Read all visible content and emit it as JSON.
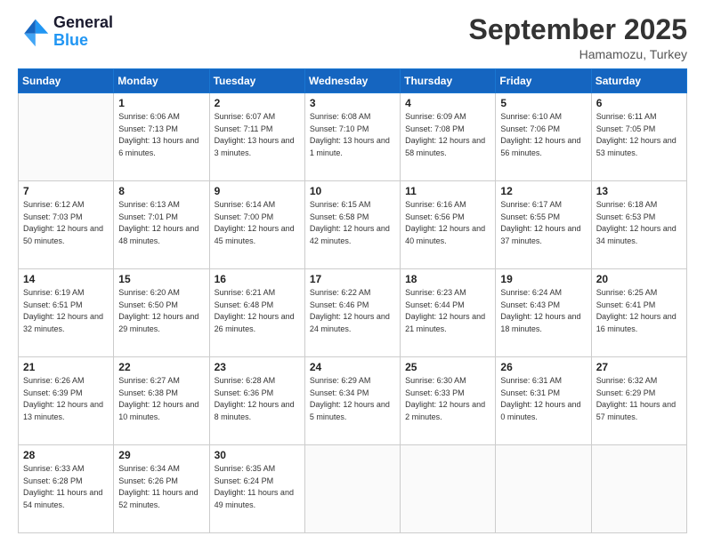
{
  "logo": {
    "line1": "General",
    "line2": "Blue"
  },
  "title": "September 2025",
  "subtitle": "Hamamozu, Turkey",
  "days_header": [
    "Sunday",
    "Monday",
    "Tuesday",
    "Wednesday",
    "Thursday",
    "Friday",
    "Saturday"
  ],
  "weeks": [
    [
      {
        "num": "",
        "sunrise": "",
        "sunset": "",
        "daylight": ""
      },
      {
        "num": "1",
        "sunrise": "Sunrise: 6:06 AM",
        "sunset": "Sunset: 7:13 PM",
        "daylight": "Daylight: 13 hours and 6 minutes."
      },
      {
        "num": "2",
        "sunrise": "Sunrise: 6:07 AM",
        "sunset": "Sunset: 7:11 PM",
        "daylight": "Daylight: 13 hours and 3 minutes."
      },
      {
        "num": "3",
        "sunrise": "Sunrise: 6:08 AM",
        "sunset": "Sunset: 7:10 PM",
        "daylight": "Daylight: 13 hours and 1 minute."
      },
      {
        "num": "4",
        "sunrise": "Sunrise: 6:09 AM",
        "sunset": "Sunset: 7:08 PM",
        "daylight": "Daylight: 12 hours and 58 minutes."
      },
      {
        "num": "5",
        "sunrise": "Sunrise: 6:10 AM",
        "sunset": "Sunset: 7:06 PM",
        "daylight": "Daylight: 12 hours and 56 minutes."
      },
      {
        "num": "6",
        "sunrise": "Sunrise: 6:11 AM",
        "sunset": "Sunset: 7:05 PM",
        "daylight": "Daylight: 12 hours and 53 minutes."
      }
    ],
    [
      {
        "num": "7",
        "sunrise": "Sunrise: 6:12 AM",
        "sunset": "Sunset: 7:03 PM",
        "daylight": "Daylight: 12 hours and 50 minutes."
      },
      {
        "num": "8",
        "sunrise": "Sunrise: 6:13 AM",
        "sunset": "Sunset: 7:01 PM",
        "daylight": "Daylight: 12 hours and 48 minutes."
      },
      {
        "num": "9",
        "sunrise": "Sunrise: 6:14 AM",
        "sunset": "Sunset: 7:00 PM",
        "daylight": "Daylight: 12 hours and 45 minutes."
      },
      {
        "num": "10",
        "sunrise": "Sunrise: 6:15 AM",
        "sunset": "Sunset: 6:58 PM",
        "daylight": "Daylight: 12 hours and 42 minutes."
      },
      {
        "num": "11",
        "sunrise": "Sunrise: 6:16 AM",
        "sunset": "Sunset: 6:56 PM",
        "daylight": "Daylight: 12 hours and 40 minutes."
      },
      {
        "num": "12",
        "sunrise": "Sunrise: 6:17 AM",
        "sunset": "Sunset: 6:55 PM",
        "daylight": "Daylight: 12 hours and 37 minutes."
      },
      {
        "num": "13",
        "sunrise": "Sunrise: 6:18 AM",
        "sunset": "Sunset: 6:53 PM",
        "daylight": "Daylight: 12 hours and 34 minutes."
      }
    ],
    [
      {
        "num": "14",
        "sunrise": "Sunrise: 6:19 AM",
        "sunset": "Sunset: 6:51 PM",
        "daylight": "Daylight: 12 hours and 32 minutes."
      },
      {
        "num": "15",
        "sunrise": "Sunrise: 6:20 AM",
        "sunset": "Sunset: 6:50 PM",
        "daylight": "Daylight: 12 hours and 29 minutes."
      },
      {
        "num": "16",
        "sunrise": "Sunrise: 6:21 AM",
        "sunset": "Sunset: 6:48 PM",
        "daylight": "Daylight: 12 hours and 26 minutes."
      },
      {
        "num": "17",
        "sunrise": "Sunrise: 6:22 AM",
        "sunset": "Sunset: 6:46 PM",
        "daylight": "Daylight: 12 hours and 24 minutes."
      },
      {
        "num": "18",
        "sunrise": "Sunrise: 6:23 AM",
        "sunset": "Sunset: 6:44 PM",
        "daylight": "Daylight: 12 hours and 21 minutes."
      },
      {
        "num": "19",
        "sunrise": "Sunrise: 6:24 AM",
        "sunset": "Sunset: 6:43 PM",
        "daylight": "Daylight: 12 hours and 18 minutes."
      },
      {
        "num": "20",
        "sunrise": "Sunrise: 6:25 AM",
        "sunset": "Sunset: 6:41 PM",
        "daylight": "Daylight: 12 hours and 16 minutes."
      }
    ],
    [
      {
        "num": "21",
        "sunrise": "Sunrise: 6:26 AM",
        "sunset": "Sunset: 6:39 PM",
        "daylight": "Daylight: 12 hours and 13 minutes."
      },
      {
        "num": "22",
        "sunrise": "Sunrise: 6:27 AM",
        "sunset": "Sunset: 6:38 PM",
        "daylight": "Daylight: 12 hours and 10 minutes."
      },
      {
        "num": "23",
        "sunrise": "Sunrise: 6:28 AM",
        "sunset": "Sunset: 6:36 PM",
        "daylight": "Daylight: 12 hours and 8 minutes."
      },
      {
        "num": "24",
        "sunrise": "Sunrise: 6:29 AM",
        "sunset": "Sunset: 6:34 PM",
        "daylight": "Daylight: 12 hours and 5 minutes."
      },
      {
        "num": "25",
        "sunrise": "Sunrise: 6:30 AM",
        "sunset": "Sunset: 6:33 PM",
        "daylight": "Daylight: 12 hours and 2 minutes."
      },
      {
        "num": "26",
        "sunrise": "Sunrise: 6:31 AM",
        "sunset": "Sunset: 6:31 PM",
        "daylight": "Daylight: 12 hours and 0 minutes."
      },
      {
        "num": "27",
        "sunrise": "Sunrise: 6:32 AM",
        "sunset": "Sunset: 6:29 PM",
        "daylight": "Daylight: 11 hours and 57 minutes."
      }
    ],
    [
      {
        "num": "28",
        "sunrise": "Sunrise: 6:33 AM",
        "sunset": "Sunset: 6:28 PM",
        "daylight": "Daylight: 11 hours and 54 minutes."
      },
      {
        "num": "29",
        "sunrise": "Sunrise: 6:34 AM",
        "sunset": "Sunset: 6:26 PM",
        "daylight": "Daylight: 11 hours and 52 minutes."
      },
      {
        "num": "30",
        "sunrise": "Sunrise: 6:35 AM",
        "sunset": "Sunset: 6:24 PM",
        "daylight": "Daylight: 11 hours and 49 minutes."
      },
      {
        "num": "",
        "sunrise": "",
        "sunset": "",
        "daylight": ""
      },
      {
        "num": "",
        "sunrise": "",
        "sunset": "",
        "daylight": ""
      },
      {
        "num": "",
        "sunrise": "",
        "sunset": "",
        "daylight": ""
      },
      {
        "num": "",
        "sunrise": "",
        "sunset": "",
        "daylight": ""
      }
    ]
  ]
}
